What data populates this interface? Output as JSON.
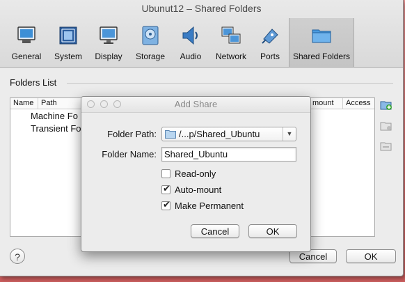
{
  "window": {
    "title": "Ubunut12 – Shared Folders"
  },
  "toolbar": {
    "items": [
      {
        "label": "General",
        "icon": "general-icon"
      },
      {
        "label": "System",
        "icon": "system-icon"
      },
      {
        "label": "Display",
        "icon": "display-icon"
      },
      {
        "label": "Storage",
        "icon": "storage-icon"
      },
      {
        "label": "Audio",
        "icon": "audio-icon"
      },
      {
        "label": "Network",
        "icon": "network-icon"
      },
      {
        "label": "Ports",
        "icon": "ports-icon"
      },
      {
        "label": "Shared Folders",
        "icon": "shared-folders-icon",
        "active": true
      }
    ]
  },
  "folders": {
    "section_title": "Folders List",
    "columns": [
      "Name",
      "Path",
      "mount",
      "Access"
    ],
    "rows": [
      "Machine Fo",
      "Transient Fo"
    ]
  },
  "footer": {
    "help": "?",
    "cancel": "Cancel",
    "ok": "OK"
  },
  "dialog": {
    "title": "Add Share",
    "folder_path_label": "Folder Path:",
    "folder_path_value": "/...p/Shared_Ubuntu",
    "folder_name_label": "Folder Name:",
    "folder_name_value": "Shared_Ubuntu",
    "read_only": {
      "label": "Read-only",
      "checked": false
    },
    "auto_mount": {
      "label": "Auto-mount",
      "checked": true
    },
    "make_permanent": {
      "label": "Make Permanent",
      "checked": true
    },
    "cancel": "Cancel",
    "ok": "OK"
  },
  "colors": {
    "accent": "#3d8fd6",
    "background": "#ececec"
  }
}
